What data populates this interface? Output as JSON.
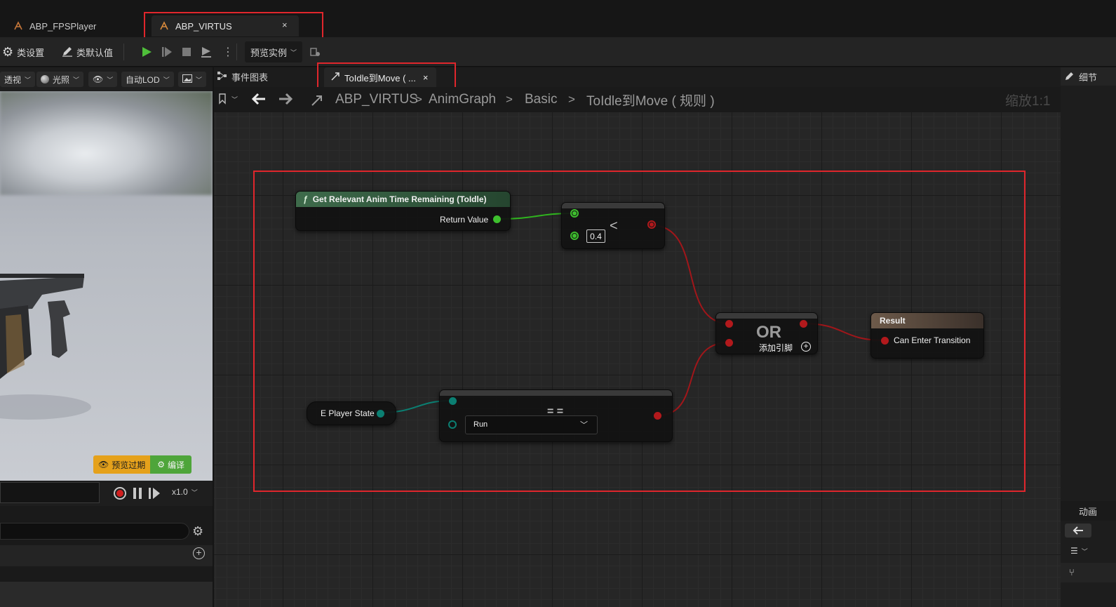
{
  "tabs": [
    {
      "label": "ABP_FPSPlayer"
    },
    {
      "label": "ABP_VIRTUS",
      "close": "×"
    }
  ],
  "toolbar": {
    "class_settings": "类设置",
    "class_defaults": "类默认值",
    "preview_instance": "预览实例"
  },
  "viewport_bar": {
    "perspective": "透视",
    "lighting": "光照",
    "lod": "自动LOD"
  },
  "viewport": {
    "badge_preview": "预览过期",
    "badge_compile": "编译",
    "speed": "x1.0"
  },
  "graph_tabs": {
    "event_graph": "事件图表",
    "rule_tab": "ToIdle到Move ( ...",
    "rule_tab_close": "×"
  },
  "breadcrumb": {
    "items": [
      "ABP_VIRTUS",
      "AnimGraph",
      "Basic",
      "ToIdle到Move ( 规则 )"
    ],
    "separators": [
      ">",
      ">",
      ">"
    ],
    "zoom": "缩放1:1"
  },
  "nodes": {
    "get_time": {
      "title": "Get Relevant Anim Time Remaining (ToIdle)",
      "pin": "Return Value",
      "func_icon": "ƒ"
    },
    "less": {
      "op": "<",
      "value": "0.4"
    },
    "or": {
      "title": "OR",
      "add_pin": "添加引脚"
    },
    "result": {
      "title": "Result",
      "pin": "Can Enter Transition"
    },
    "player_state": {
      "label": "E Player State"
    },
    "equal": {
      "op": "= =",
      "enum_value": "Run"
    }
  },
  "right_panel": {
    "details": "细节",
    "anim": "动画"
  },
  "colors": {
    "bool_pin": "#b2191c",
    "float_pin": "#3ec02e",
    "enum_pin": "#0b7f72",
    "highlight": "#e0262c"
  }
}
